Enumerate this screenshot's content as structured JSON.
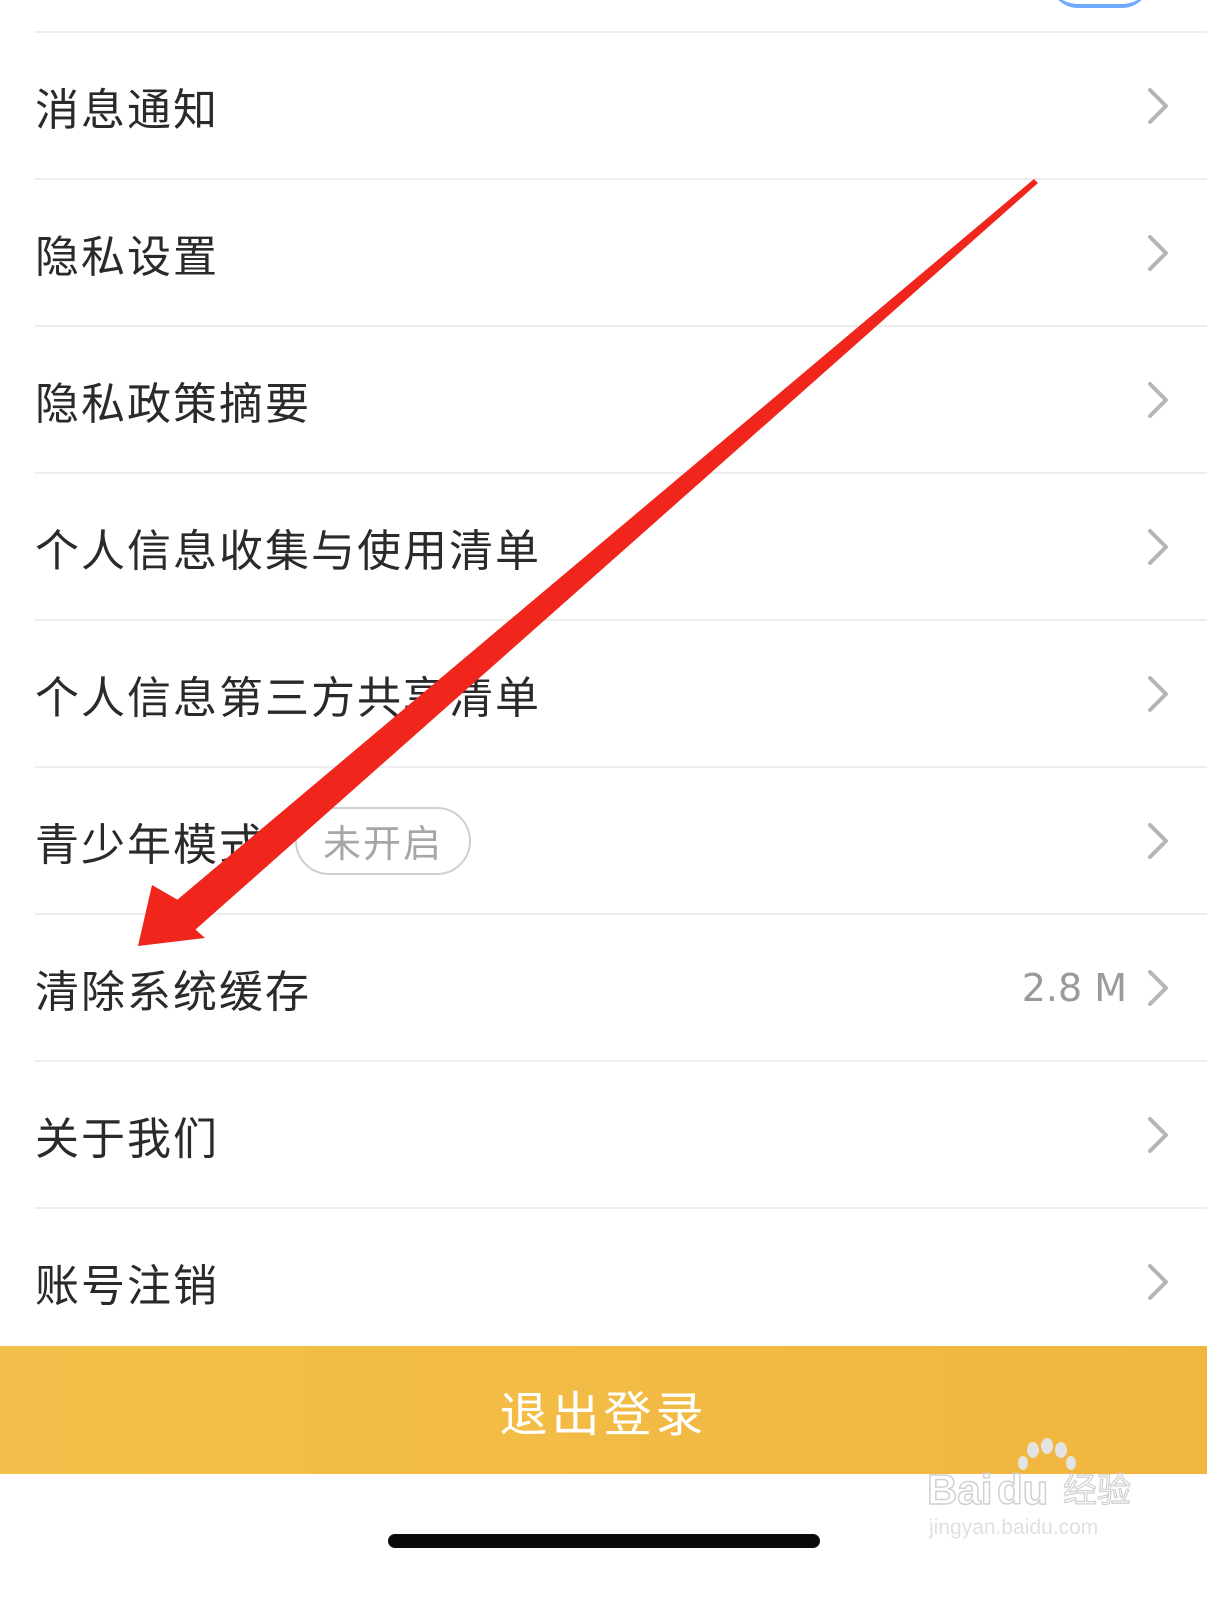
{
  "settings": {
    "items": [
      {
        "label": "消息通知",
        "badge": "",
        "value": ""
      },
      {
        "label": "隐私设置",
        "badge": "",
        "value": ""
      },
      {
        "label": "隐私政策摘要",
        "badge": "",
        "value": ""
      },
      {
        "label": "个人信息收集与使用清单",
        "badge": "",
        "value": ""
      },
      {
        "label": "个人信息第三方共享清单",
        "badge": "",
        "value": ""
      },
      {
        "label": "青少年模式",
        "badge": "未开启",
        "value": ""
      },
      {
        "label": "清除系统缓存",
        "badge": "",
        "value": "2.8 M"
      },
      {
        "label": "关于我们",
        "badge": "",
        "value": ""
      },
      {
        "label": "账号注销",
        "badge": "",
        "value": ""
      }
    ]
  },
  "logout_button": {
    "label": "退出登录"
  },
  "watermark": {
    "brand": "Baidu经验",
    "url": "jingyan.baidu.com"
  },
  "icons": {
    "row_chevron": "chevron-right-icon",
    "annotation": "red-arrow-icon"
  },
  "colors": {
    "logout_bg": "#f2bd45",
    "arrow": "#f0261c",
    "text": "#2a2a2a",
    "secondary": "#9a9a9a"
  }
}
